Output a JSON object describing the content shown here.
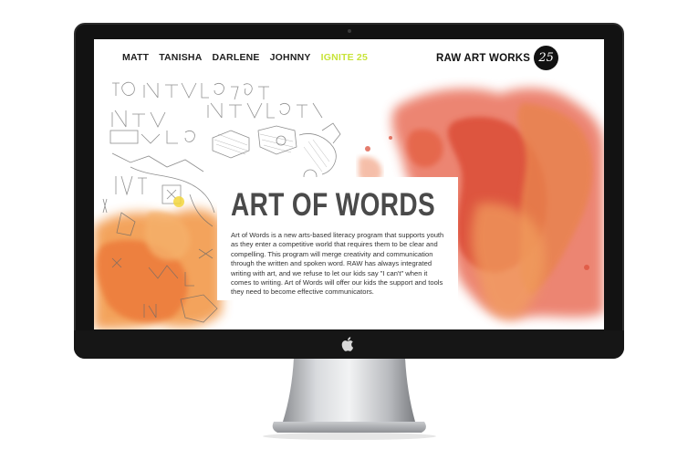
{
  "nav": {
    "items": [
      {
        "label": "MATT",
        "active": false
      },
      {
        "label": "TANISHA",
        "active": false
      },
      {
        "label": "DARLENE",
        "active": false
      },
      {
        "label": "JOHNNY",
        "active": false
      },
      {
        "label": "IGNITE 25",
        "active": true
      }
    ]
  },
  "brand": {
    "name": "RAW ART WORKS",
    "badge": "25"
  },
  "card": {
    "title": "ART OF WORDS",
    "body": "Art of Words is a new arts-based literacy program that supports youth as they enter a competitive world that requires them to be clear and compelling. This program will merge creativity and communication through the written and spoken word. RAW has always integrated writing with art, and we refuse to let our kids say \"I can't\" when it comes to writing. Art of Words will offer our kids the support and tools they need to become effective communicators."
  },
  "colors": {
    "accent": "#c8e43a",
    "watercolor_red": "#e0553a",
    "watercolor_orange": "#f0883a",
    "bezel": "#121212"
  },
  "icons": {
    "apple": "apple-icon",
    "badge": "circle-25-badge"
  }
}
